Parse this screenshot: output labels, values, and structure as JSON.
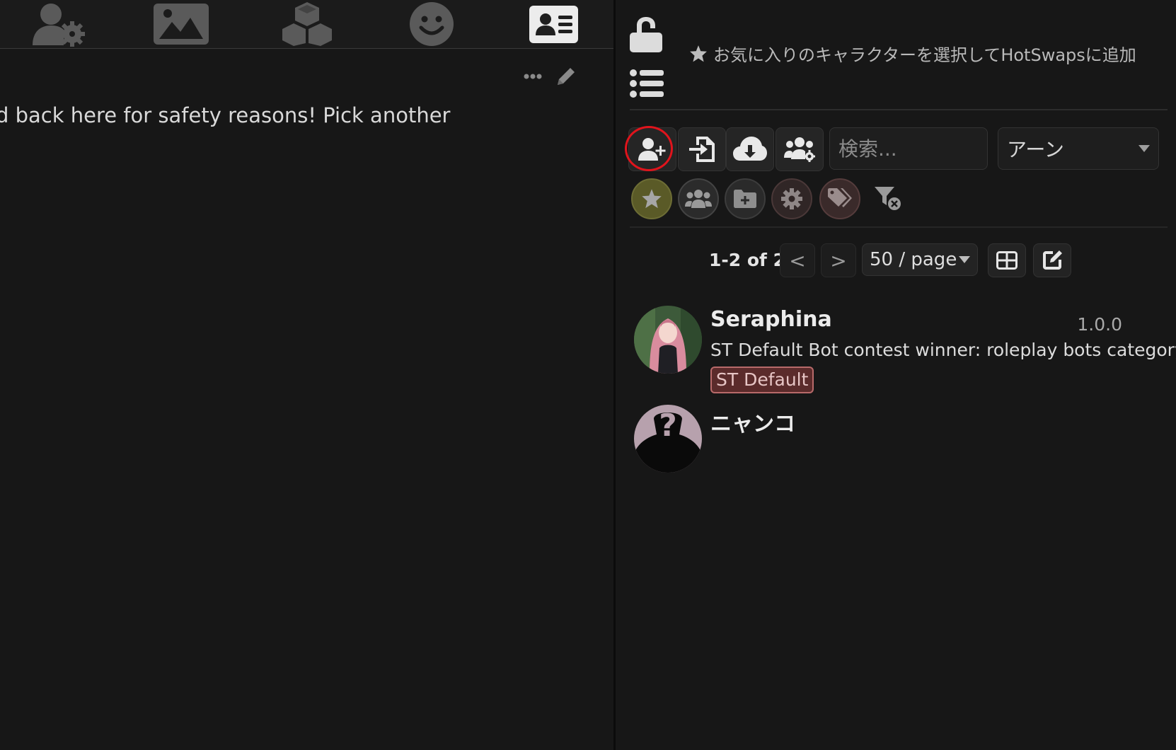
{
  "chat": {
    "message_text": "d back here for safety reasons! Pick another"
  },
  "right_panel": {
    "hotswap_hint": "お気に入りのキャラクターを選択してHotSwapsに追加",
    "search_placeholder": "検索...",
    "sort_value": "アーン",
    "pagination": {
      "count": "1-2 of 2",
      "prev_label": "<",
      "next_label": ">",
      "page_size": "50 / page"
    },
    "characters": [
      {
        "name": "Seraphina",
        "version": "1.0.0",
        "description": "ST Default Bot contest winner: roleplay bots category",
        "tag": "ST Default"
      },
      {
        "name": "ニャンコ"
      }
    ]
  },
  "colors": {
    "background": "#171717",
    "highlight_ring": "#e0141c",
    "favorite_filter": "#5a5a27",
    "tag_background": "#5b2b2b",
    "tag_border": "#b86a6a"
  },
  "icons": {
    "nav": [
      "user-settings-icon",
      "image-icon",
      "cubes-icon",
      "smile-icon",
      "address-card-icon"
    ],
    "toolbar": [
      "user-plus-icon",
      "file-import-icon",
      "cloud-download-icon",
      "users-gear-icon"
    ],
    "filters": [
      "star-icon",
      "users-icon",
      "folder-plus-icon",
      "gear-icon",
      "tags-icon",
      "filter-clear-icon"
    ]
  }
}
